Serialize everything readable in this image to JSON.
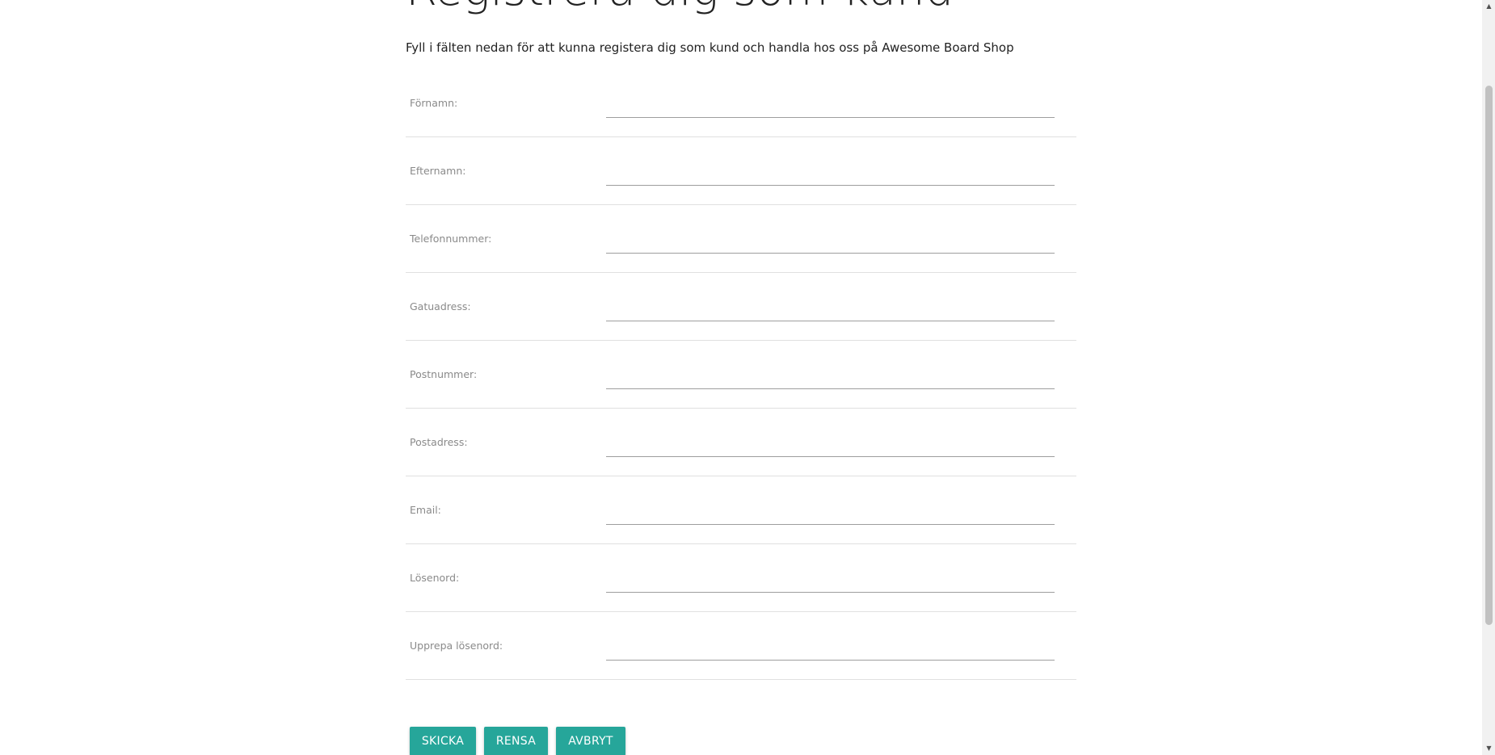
{
  "page": {
    "title": "Registrera dig som kund",
    "intro": "Fyll i fälten nedan för att kunna registera dig som kund och handla hos oss på Awesome Board Shop"
  },
  "form": {
    "fields": [
      {
        "label": "Förnamn:",
        "value": "",
        "placeholder": ""
      },
      {
        "label": "Efternamn:",
        "value": "",
        "placeholder": ""
      },
      {
        "label": "Telefonnummer:",
        "value": "",
        "placeholder": ""
      },
      {
        "label": "Gatuadress:",
        "value": "",
        "placeholder": ""
      },
      {
        "label": "Postnummer:",
        "value": "",
        "placeholder": ""
      },
      {
        "label": "Postadress:",
        "value": "",
        "placeholder": ""
      },
      {
        "label": "Email:",
        "value": "",
        "placeholder": ""
      },
      {
        "label": "Lösenord:",
        "value": "",
        "placeholder": ""
      },
      {
        "label": "Upprepa lösenord:",
        "value": "",
        "placeholder": ""
      }
    ]
  },
  "buttons": {
    "submit": "SKICKA",
    "reset": "RENSA",
    "cancel": "AVBRYT"
  },
  "colors": {
    "button_bg": "#26a69a",
    "button_text": "#ffffff",
    "label_text": "#8a8a8a",
    "row_divider": "#e0e0e0",
    "input_underline": "#9e9e9e"
  },
  "icons": {
    "scroll_up": "scroll-up-arrow-icon",
    "scroll_down": "scroll-down-arrow-icon"
  }
}
